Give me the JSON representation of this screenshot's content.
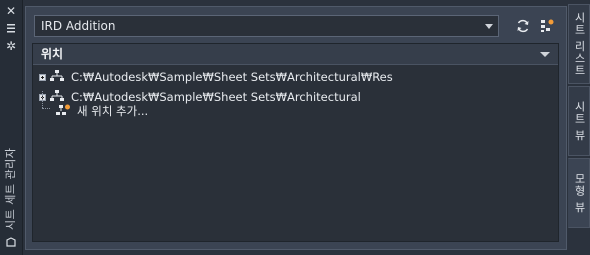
{
  "left_strip": {
    "close_icon": "close-icon",
    "autohide_icon": "autohide-icon",
    "properties_icon": "properties-icon",
    "title": "시트 세트 관리자"
  },
  "toolbar": {
    "sheet_set_value": "IRD Addition",
    "refresh_icon": "refresh-icon",
    "options_icon": "sheet-options-icon"
  },
  "panel": {
    "header": "위치",
    "locations": [
      {
        "path": "C:₩Autodesk₩Sample₩Sheet Sets₩Architectural₩Res"
      },
      {
        "path": "C:₩Autodesk₩Sample₩Sheet Sets₩Architectural"
      }
    ],
    "add_location": "새 위치 추가..."
  },
  "tabs": [
    {
      "label": "시트 리스트",
      "active": false
    },
    {
      "label": "시트 뷰",
      "active": false
    },
    {
      "label": "모형 뷰",
      "active": true
    }
  ],
  "colors": {
    "accent_orange": "#f39c38",
    "background": "#2b323d"
  }
}
